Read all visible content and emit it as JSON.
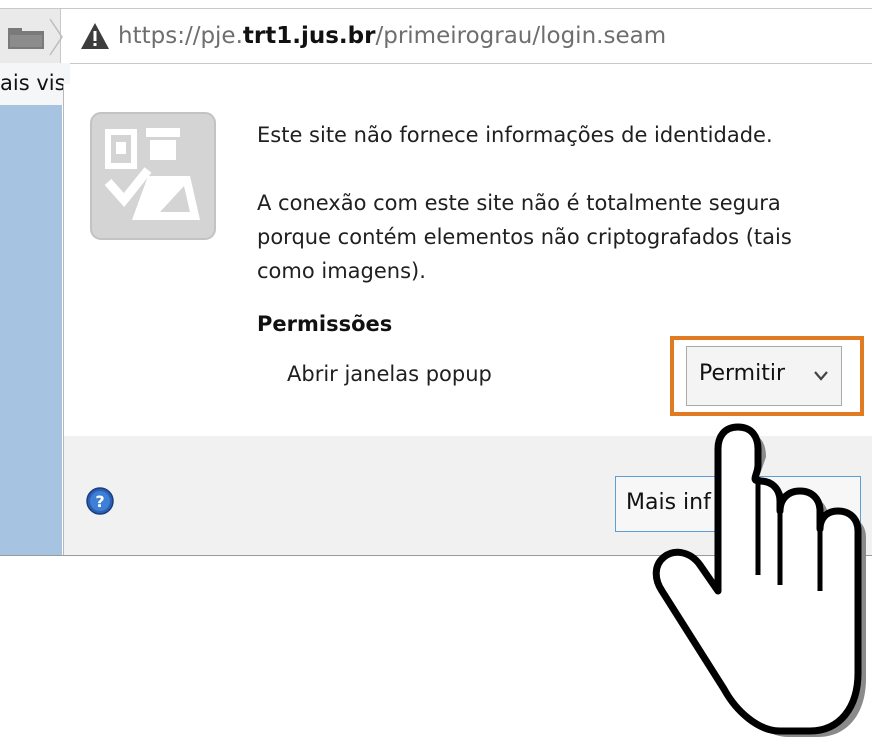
{
  "address_bar": {
    "url_prefix": "https://pje.",
    "url_domain": "trt1.jus.br",
    "url_path": "/primeirograu/login.seam"
  },
  "bookmarks_bar": {
    "partial_item": "ais vis"
  },
  "identity_panel": {
    "message_1": "Este site não fornece informações de identidade.",
    "message_2_lines": [
      "A conexão com este site não é totalmente segura",
      "porque contém elementos não criptografados (tais",
      "como imagens)."
    ],
    "permissions_title": "Permissões",
    "permission_label": "Abrir janelas popup",
    "permission_value": "Permitir",
    "more_info_button": "Mais inf"
  },
  "colors": {
    "highlight": "#e07b22",
    "button_border": "#5e9ed6",
    "page_strip": "#a7c3e2"
  },
  "icons": [
    "folder-icon",
    "warning-icon",
    "passport-icon",
    "chevron-down-icon",
    "help-icon",
    "hand-cursor-icon"
  ]
}
